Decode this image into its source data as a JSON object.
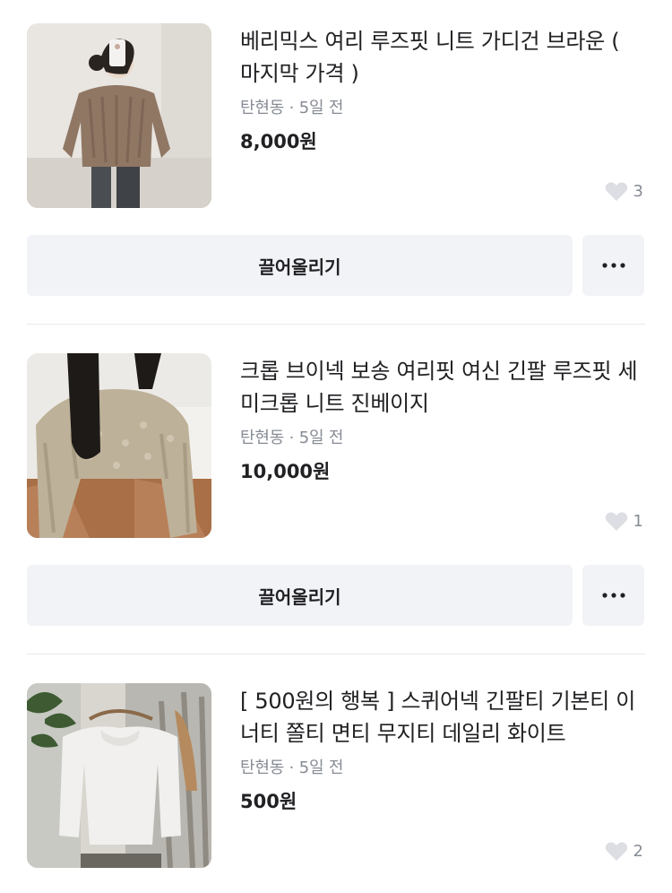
{
  "products": [
    {
      "title": "베리믹스 여리 루즈핏 니트 가디건 브라운 ( 마지막 가격 )",
      "location": "탄현동",
      "time": "5일 전",
      "price": "8,000원",
      "likes": "3",
      "image_icon": "photo-cardigan-brown"
    },
    {
      "title": "크롭 브이넥 보송 여리핏 여신 긴팔 루즈핏 세미크롭 니트 진베이지",
      "location": "탄현동",
      "time": "5일 전",
      "price": "10,000원",
      "likes": "1",
      "image_icon": "photo-knit-beige"
    },
    {
      "title": "[ 500원의 행복 ] 스퀴어넥 긴팔티 기본티 이너티 쫄티 면티 무지티 데일리 화이트",
      "location": "탄현동",
      "time": "5일 전",
      "price": "500원",
      "likes": "2",
      "image_icon": "photo-tee-white"
    }
  ],
  "actions": {
    "bump_label": "끌어올리기",
    "more_icon": "more-dots-icon"
  },
  "meta_separator": "·",
  "colors": {
    "text_primary": "#212124",
    "text_secondary": "#868b94",
    "button_bg": "#f2f3f6",
    "divider": "#e9ebee"
  }
}
